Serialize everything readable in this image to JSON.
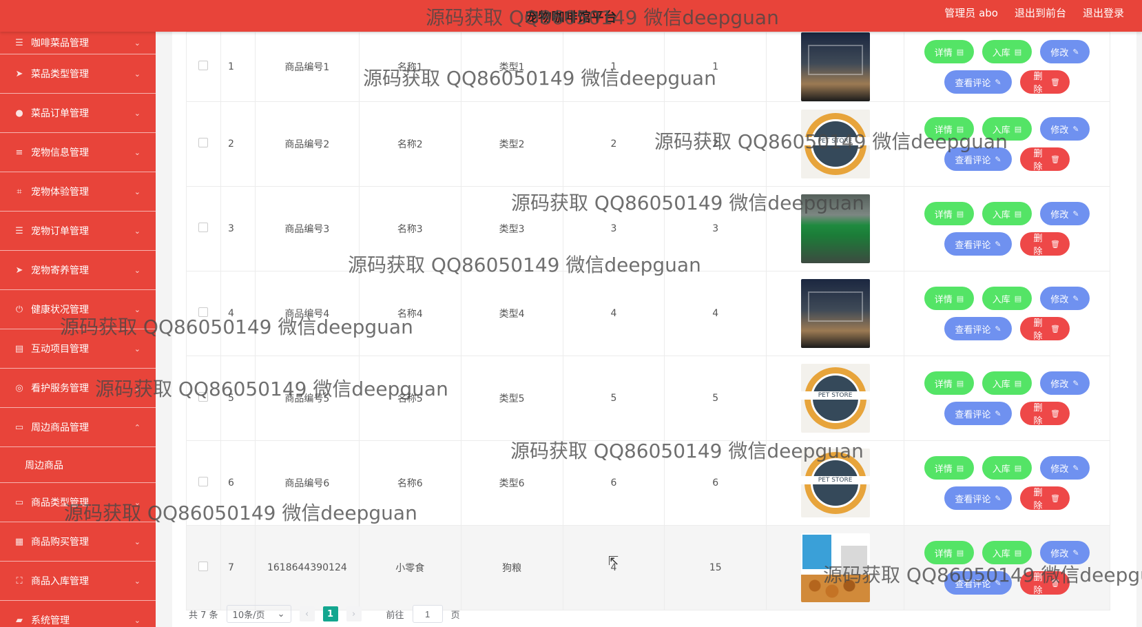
{
  "header": {
    "title": "宠物咖啡馆平台",
    "links": [
      "管理员 abo",
      "退出到前台",
      "退出登录"
    ]
  },
  "sidebar": {
    "items": [
      {
        "label": "咖啡菜品管理",
        "icon": "list-icon"
      },
      {
        "label": "菜品类型管理",
        "icon": "send-icon"
      },
      {
        "label": "菜品订单管理",
        "icon": "user-icon"
      },
      {
        "label": "宠物信息管理",
        "icon": "sliders-icon"
      },
      {
        "label": "宠物体验管理",
        "icon": "crop-icon"
      },
      {
        "label": "宠物订单管理",
        "icon": "list-icon"
      },
      {
        "label": "宠物寄养管理",
        "icon": "send-icon"
      },
      {
        "label": "健康状况管理",
        "icon": "power-icon"
      },
      {
        "label": "互动项目管理",
        "icon": "book-icon"
      },
      {
        "label": "看护服务管理",
        "icon": "compass-icon"
      },
      {
        "label": "周边商品管理",
        "icon": "chat-icon",
        "expanded": true
      },
      {
        "label": "商品类型管理",
        "icon": "chat-icon"
      },
      {
        "label": "商品购买管理",
        "icon": "grid-icon"
      },
      {
        "label": "商品入库管理",
        "icon": "frame-icon"
      },
      {
        "label": "系统管理",
        "icon": "cart-icon"
      }
    ],
    "sub_item": "周边商品"
  },
  "table": {
    "rows": [
      {
        "idx": "1",
        "code": "商品编号1",
        "name": "名称1",
        "type": "类型1",
        "n1": "1",
        "n2": "1",
        "img": "shop"
      },
      {
        "idx": "2",
        "code": "商品编号2",
        "name": "名称2",
        "type": "类型2",
        "n1": "2",
        "n2": "2",
        "img": "badge"
      },
      {
        "idx": "3",
        "code": "商品编号3",
        "name": "名称3",
        "type": "类型3",
        "n1": "3",
        "n2": "3",
        "img": "green"
      },
      {
        "idx": "4",
        "code": "商品编号4",
        "name": "名称4",
        "type": "类型4",
        "n1": "4",
        "n2": "4",
        "img": "shop"
      },
      {
        "idx": "5",
        "code": "商品编号5",
        "name": "名称5",
        "type": "类型5",
        "n1": "5",
        "n2": "5",
        "img": "badge"
      },
      {
        "idx": "6",
        "code": "商品编号6",
        "name": "名称6",
        "type": "类型6",
        "n1": "6",
        "n2": "6",
        "img": "badge"
      },
      {
        "idx": "7",
        "code": "1618644390124",
        "name": "小零食",
        "type": "狗粮",
        "n1": "4",
        "n2": "15",
        "img": "food"
      }
    ],
    "badge_text": "PET STORE",
    "buttons": {
      "detail": "详情",
      "stock": "入库",
      "edit": "修改",
      "review": "查看评论",
      "delete": "删除"
    }
  },
  "pagination": {
    "total": "共 7 条",
    "page_size": "10条/页",
    "current_page": "1",
    "goto_label": "前往",
    "goto_value": "1",
    "page_unit": "页"
  },
  "watermark": "源码获取 QQ86050149 微信deepguan",
  "colors": {
    "primary": "#e8443a",
    "green": "#54e466",
    "blue": "#6f91f0",
    "red": "#ee4848",
    "page_active": "#13a68f"
  }
}
